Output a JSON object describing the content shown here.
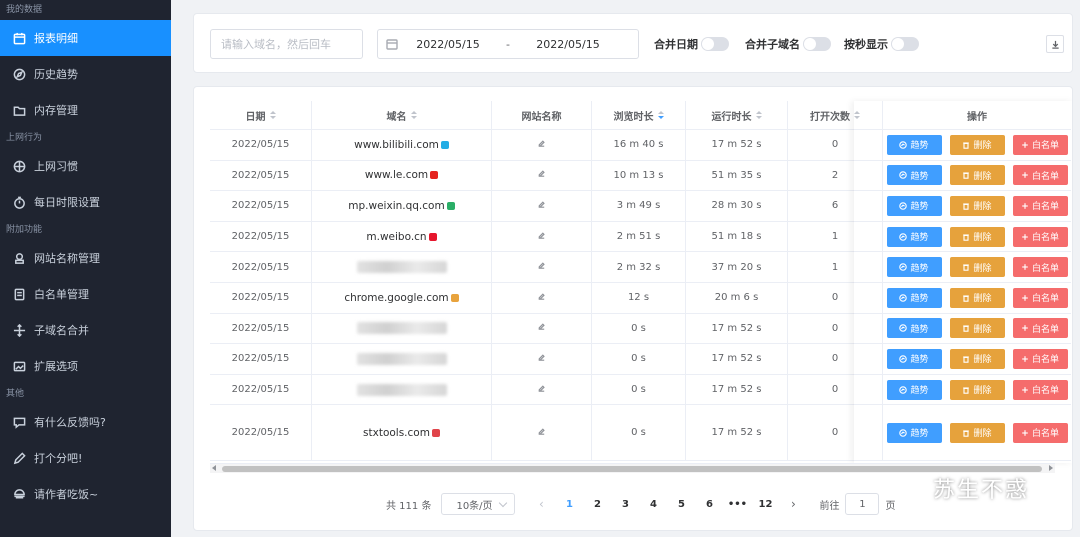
{
  "sidebar": {
    "sections": [
      {
        "title": "我的数据",
        "items": [
          {
            "label": "报表明细",
            "icon": "calendar-icon",
            "active": true
          },
          {
            "label": "历史趋势",
            "icon": "compass-icon"
          },
          {
            "label": "内存管理",
            "icon": "folder-icon"
          }
        ]
      },
      {
        "title": "上网行为",
        "items": [
          {
            "label": "上网习惯",
            "icon": "target-icon"
          },
          {
            "label": "每日时限设置",
            "icon": "timer-icon"
          }
        ]
      },
      {
        "title": "附加功能",
        "items": [
          {
            "label": "网站名称管理",
            "icon": "bank-icon"
          },
          {
            "label": "白名单管理",
            "icon": "document-icon"
          },
          {
            "label": "子域名合并",
            "icon": "move-icon"
          },
          {
            "label": "扩展选项",
            "icon": "picture-icon"
          }
        ]
      },
      {
        "title": "其他",
        "items": [
          {
            "label": "有什么反馈吗?",
            "icon": "chat-icon"
          },
          {
            "label": "打个分吧!",
            "icon": "pen-icon"
          },
          {
            "label": "请作者吃饭~",
            "icon": "food-icon"
          }
        ]
      }
    ]
  },
  "filter": {
    "search_placeholder": "请输入域名，然后回车",
    "date_start": "2022/05/15",
    "date_separator": "-",
    "date_end": "2022/05/15",
    "toggle_merge_date": "合并日期",
    "toggle_merge_subdomain": "合并子域名",
    "toggle_show_seconds": "按秒显示"
  },
  "table": {
    "headers": {
      "date": "日期",
      "domain": "域名",
      "site_name": "网站名称",
      "browse_time": "浏览时长",
      "run_time": "运行时长",
      "open_count": "打开次数",
      "operations": "操作"
    },
    "rows": [
      {
        "date": "2022/05/15",
        "domain": "www.bilibili.com",
        "browse": "16 m 40 s",
        "run": "17 m 52 s",
        "open": "0",
        "fav_color": "#23ade5"
      },
      {
        "date": "2022/05/15",
        "domain": "www.le.com",
        "browse": "10 m 13 s",
        "run": "51 m 35 s",
        "open": "2",
        "fav_color": "#e52420"
      },
      {
        "date": "2022/05/15",
        "domain": "mp.weixin.qq.com",
        "browse": "3 m 49 s",
        "run": "28 m 30 s",
        "open": "6",
        "fav_color": "#2aae67"
      },
      {
        "date": "2022/05/15",
        "domain": "m.weibo.cn",
        "browse": "2 m 51 s",
        "run": "51 m 18 s",
        "open": "1",
        "fav_color": "#e6162d"
      },
      {
        "date": "2022/05/15",
        "domain": "",
        "browse": "2 m 32 s",
        "run": "37 m 20 s",
        "open": "1",
        "fav_color": ""
      },
      {
        "date": "2022/05/15",
        "domain": "chrome.google.com",
        "browse": "12 s",
        "run": "20 m 6 s",
        "open": "0",
        "fav_color": "#e8a33d"
      },
      {
        "date": "2022/05/15",
        "domain": "",
        "browse": "0 s",
        "run": "17 m 52 s",
        "open": "0",
        "fav_color": ""
      },
      {
        "date": "2022/05/15",
        "domain": "",
        "browse": "0 s",
        "run": "17 m 52 s",
        "open": "0",
        "fav_color": ""
      },
      {
        "date": "2022/05/15",
        "domain": "",
        "browse": "0 s",
        "run": "17 m 52 s",
        "open": "0",
        "fav_color": ""
      },
      {
        "date": "2022/05/15",
        "domain": "stxtools.com",
        "browse": "0 s",
        "run": "17 m 52 s",
        "open": "0",
        "fav_color": "#e0444a"
      }
    ],
    "ops": {
      "trend": "趋势",
      "delete": "删除",
      "whitelist": "白名单"
    }
  },
  "pagination": {
    "total": "共 111 条",
    "page_size": "10条/页",
    "pages": [
      "1",
      "2",
      "3",
      "4",
      "5",
      "6",
      "•••",
      "12"
    ],
    "current": "1",
    "goto_label": "前往",
    "goto_value": "1",
    "goto_suffix": "页"
  },
  "watermark": {
    "text": "苏生不惑"
  },
  "colors": {
    "primary": "#409eff",
    "warning": "#e6a23c",
    "danger": "#f56c6c",
    "sidebar_bg": "#1f2430",
    "sidebar_active": "#1890ff"
  }
}
